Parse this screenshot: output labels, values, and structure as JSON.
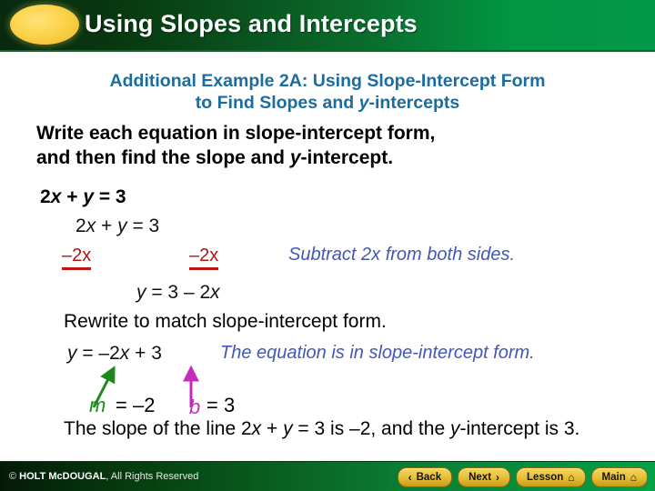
{
  "header": {
    "title": "Using Slopes and Intercepts",
    "oval_color": "#fcd34a",
    "gradient_from": "#072a10",
    "gradient_to": "#02994a"
  },
  "slide": {
    "subtitle_line1": "Additional Example 2A: Using Slope-Intercept Form",
    "subtitle_line2_pre": "to Find Slopes and ",
    "subtitle_line2_var": "y",
    "subtitle_line2_post": "-intercepts",
    "subtitle_color": "#1a6d9e",
    "instruction_line1_pre": "Write each equation in slope-intercept form,",
    "instruction_line2_pre": "and then find the slope and ",
    "instruction_line2_var": "y",
    "instruction_line2_post": "-intercept."
  },
  "work": {
    "equation_original": "2x + y = 3",
    "equation_original_parts": {
      "a": "2",
      "x": "x",
      "b": " + ",
      "y": "y",
      "c": " = 3"
    },
    "equation_restate": "2x + y = 3",
    "subtract_left": "–2x",
    "subtract_right": "–2x",
    "subtract_color": "#ab1515",
    "subtract_note": "Subtract 2x from both sides.",
    "note_color": "#4257b8",
    "equation_solved": "y = 3 – 2x",
    "rewrite_note": "Rewrite to match slope-intercept form.",
    "equation_final": "y = –2x + 3",
    "final_note": "The equation is in slope-intercept form.",
    "slope_label": "m",
    "slope_value": "= –2",
    "slope_color": "#1a8a1a",
    "intercept_label": "b",
    "intercept_value": "= 3",
    "intercept_color": "#c52bbd",
    "conclusion_part1": "The slope of the line 2",
    "conclusion_x": "x",
    "conclusion_part2": " + ",
    "conclusion_y": "y",
    "conclusion_part3": " = 3 is –2, and the ",
    "conclusion_y2": "y",
    "conclusion_part4": "-intercept is 3."
  },
  "footer": {
    "copyright_symbol": "© ",
    "copyright_brand": "HOLT McDOUGAL",
    "copyright_rest": ", All Rights Reserved",
    "buttons": [
      {
        "label": "Back",
        "icon": "chevron-left-icon",
        "glyph": "‹",
        "icon_side": "left"
      },
      {
        "label": "Next",
        "icon": "chevron-right-icon",
        "glyph": "›",
        "icon_side": "right"
      },
      {
        "label": "Lesson",
        "icon": "home-icon",
        "glyph": "⌂",
        "icon_side": "right"
      },
      {
        "label": "Main",
        "icon": "home-icon",
        "glyph": "⌂",
        "icon_side": "right"
      }
    ]
  }
}
